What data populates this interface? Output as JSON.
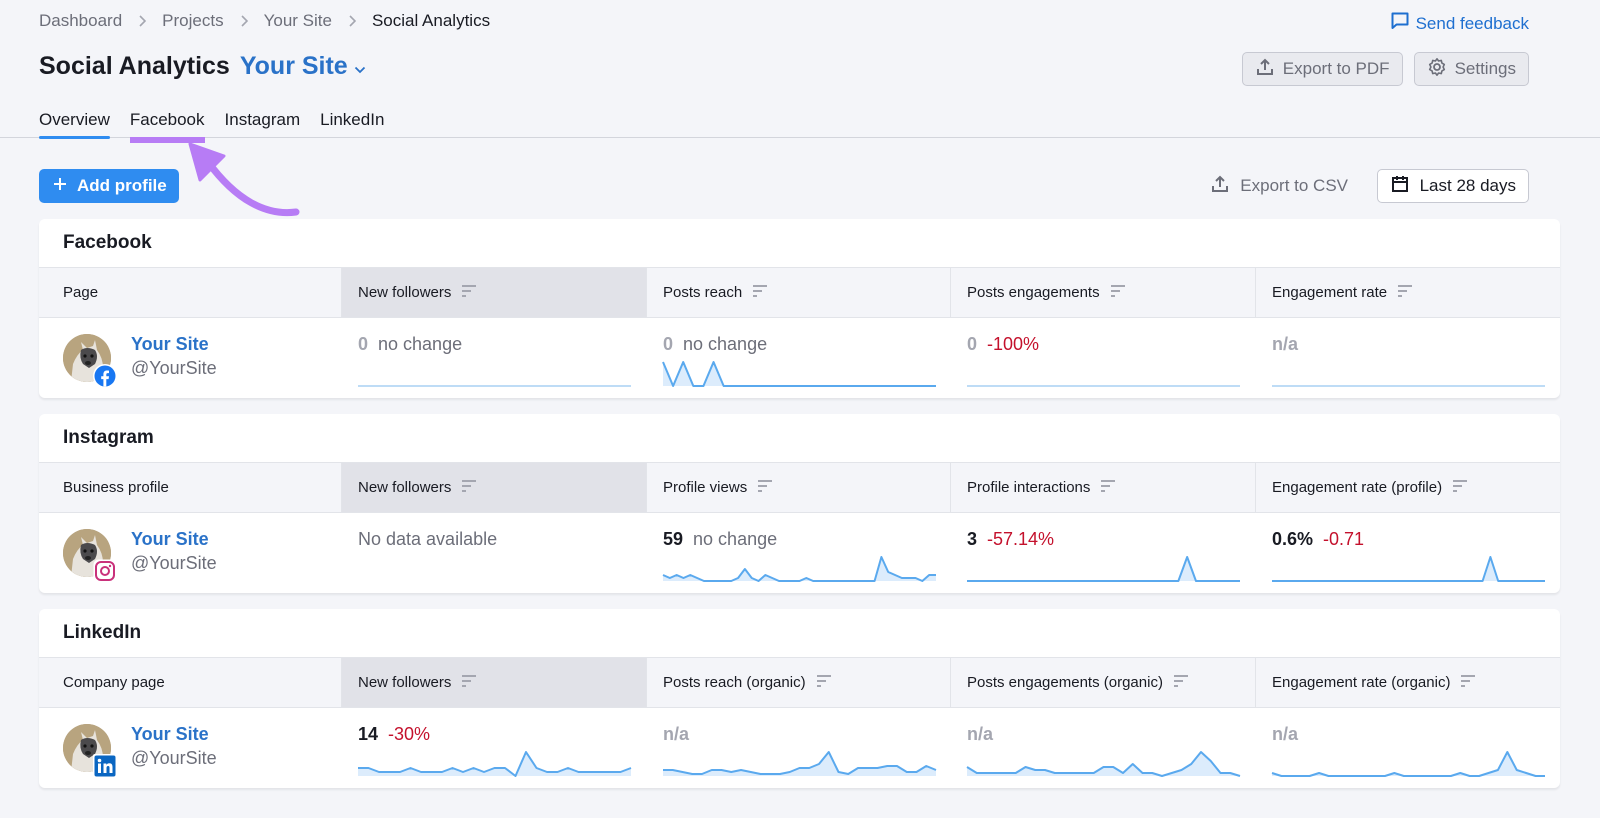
{
  "breadcrumb": [
    "Dashboard",
    "Projects",
    "Your Site",
    "Social Analytics"
  ],
  "feedback_label": "Send feedback",
  "header": {
    "title": "Social Analytics",
    "site": "Your Site",
    "export_pdf": "Export to PDF",
    "settings": "Settings"
  },
  "tabs": [
    {
      "label": "Overview",
      "active": true
    },
    {
      "label": "Facebook",
      "highlighted": true
    },
    {
      "label": "Instagram"
    },
    {
      "label": "LinkedIn"
    }
  ],
  "toolbar": {
    "add_profile": "Add profile",
    "export_csv": "Export to CSV",
    "date_range": "Last 28 days"
  },
  "colors": {
    "accent": "#2f8cf0",
    "link": "#2a72c8",
    "negative": "#c4112c",
    "annotation": "#b77cf5",
    "facebook": "#1877f2",
    "linkedin": "#0a66c2",
    "instagram": "#d62976"
  },
  "sections": [
    {
      "title": "Facebook",
      "network_icon": "facebook-icon",
      "columns": [
        "Page",
        "New followers",
        "Posts reach",
        "Posts engagements",
        "Engagement rate"
      ],
      "row": {
        "name": "Your Site",
        "handle": "@YourSite",
        "metrics": [
          {
            "value": "0",
            "muted": true,
            "delta": "no change",
            "negative": false,
            "spark": [
              0,
              0,
              0,
              0,
              0,
              0,
              0,
              0,
              0,
              0,
              0,
              0,
              0,
              0,
              0,
              0,
              0,
              0,
              0,
              0,
              0,
              0,
              0,
              0,
              0,
              0,
              0,
              0
            ]
          },
          {
            "value": "0",
            "muted": true,
            "delta": "no change",
            "negative": false,
            "spark": [
              1,
              0,
              1,
              0,
              0,
              1,
              0,
              0,
              0,
              0,
              0,
              0,
              0,
              0,
              0,
              0,
              0,
              0,
              0,
              0,
              0,
              0,
              0,
              0,
              0,
              0,
              0,
              0
            ],
            "fill": true
          },
          {
            "value": "0",
            "muted": true,
            "delta": "-100%",
            "negative": true,
            "spark": [
              0,
              0,
              0,
              0,
              0,
              0,
              0,
              0,
              0,
              0,
              0,
              0,
              0,
              0,
              0,
              0,
              0,
              0,
              0,
              0,
              0,
              0,
              0,
              0,
              0,
              0,
              0,
              0
            ]
          },
          {
            "value": "n/a",
            "muted": true,
            "delta": "",
            "negative": false,
            "spark": [
              0,
              0,
              0,
              0,
              0,
              0,
              0,
              0,
              0,
              0,
              0,
              0,
              0,
              0,
              0,
              0,
              0,
              0,
              0,
              0,
              0,
              0,
              0,
              0,
              0,
              0,
              0,
              0
            ]
          }
        ]
      }
    },
    {
      "title": "Instagram",
      "network_icon": "instagram-icon",
      "columns": [
        "Business profile",
        "New followers",
        "Profile views",
        "Profile interactions",
        "Engagement rate (profile)"
      ],
      "row": {
        "name": "Your Site",
        "handle": "@YourSite",
        "metrics": [
          {
            "nodata": "No data available"
          },
          {
            "value": "59",
            "muted": false,
            "delta": "no change",
            "negative": false,
            "spark": [
              2,
              1,
              2,
              1,
              2,
              1,
              0,
              0,
              0,
              0,
              0,
              1,
              4,
              1,
              0,
              2,
              1,
              0,
              0,
              0,
              0,
              1,
              0,
              0,
              0,
              0,
              0,
              0,
              0,
              0,
              0,
              0,
              8,
              3,
              2,
              1,
              1,
              1,
              0,
              2,
              2
            ],
            "fill": true
          },
          {
            "value": "3",
            "muted": false,
            "delta": "-57.14%",
            "negative": true,
            "spark": [
              0,
              0,
              0,
              0,
              0,
              0,
              0,
              0,
              0,
              0,
              0,
              0,
              0,
              0,
              0,
              0,
              0,
              0,
              0,
              0,
              0,
              0,
              0,
              0,
              0,
              1,
              0,
              0,
              0,
              0,
              0,
              0
            ],
            "fill": true
          },
          {
            "value": "0.6%",
            "muted": false,
            "delta": "-0.71",
            "negative": true,
            "spark": [
              0,
              0,
              0,
              0,
              0,
              0,
              0,
              0,
              0,
              0,
              0,
              0,
              0,
              0,
              0,
              0,
              0,
              0,
              0,
              0,
              0,
              0,
              0,
              0,
              0,
              0,
              0,
              0,
              1,
              0,
              0,
              0,
              0,
              0,
              0,
              0
            ],
            "fill": true
          }
        ]
      }
    },
    {
      "title": "LinkedIn",
      "network_icon": "linkedin-icon",
      "columns": [
        "Company page",
        "New followers",
        "Posts reach (organic)",
        "Posts engagements (organic)",
        "Engagement rate (organic)"
      ],
      "row": {
        "name": "Your Site",
        "handle": "@YourSite",
        "metrics": [
          {
            "value": "14",
            "muted": false,
            "delta": "-30%",
            "negative": true,
            "spark": [
              2,
              2,
              1,
              1,
              1,
              2,
              1,
              1,
              1,
              2,
              1,
              2,
              1,
              2,
              2,
              0,
              6,
              2,
              1,
              1,
              2,
              1,
              1,
              1,
              1,
              1,
              2
            ],
            "fill": true
          },
          {
            "value": "n/a",
            "muted": true,
            "delta": "",
            "negative": false,
            "spark": [
              3,
              3,
              2,
              1,
              1,
              3,
              3,
              2,
              3,
              2,
              1,
              1,
              1,
              2,
              4,
              4,
              6,
              12,
              2,
              1,
              4,
              4,
              4,
              5,
              5,
              2,
              2,
              5,
              3
            ],
            "fill": true
          },
          {
            "value": "n/a",
            "muted": true,
            "delta": "",
            "negative": false,
            "spark": [
              3,
              1,
              1,
              1,
              1,
              1,
              3,
              2,
              2,
              1,
              1,
              1,
              1,
              1,
              3,
              3,
              1,
              4,
              1,
              1,
              0,
              1,
              2,
              4,
              8,
              5,
              1,
              1,
              0
            ],
            "fill": true
          },
          {
            "value": "n/a",
            "muted": true,
            "delta": "",
            "negative": false,
            "spark": [
              1,
              0,
              0,
              0,
              0,
              1,
              0,
              0,
              0,
              0,
              0,
              0,
              0,
              1,
              0,
              0,
              0,
              0,
              0,
              0,
              1,
              0,
              0,
              1,
              2,
              8,
              2,
              1,
              0,
              0
            ],
            "fill": true
          }
        ]
      }
    }
  ]
}
